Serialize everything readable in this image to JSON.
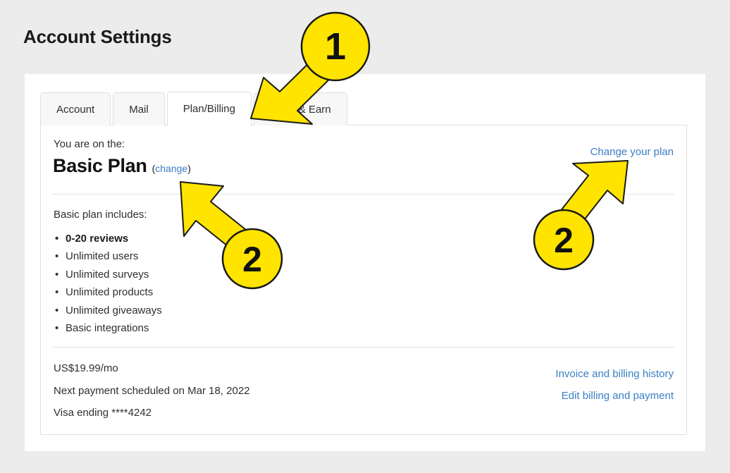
{
  "page": {
    "title": "Account Settings",
    "background_color": "#ececec",
    "card_background": "#ffffff"
  },
  "tabs": [
    {
      "label": "Account",
      "active": false
    },
    {
      "label": "Mail",
      "active": false
    },
    {
      "label": "Plan/Billing",
      "active": true
    },
    {
      "label": "Refer & Earn",
      "active": false
    }
  ],
  "plan": {
    "intro_label": "You are on the:",
    "name": "Basic Plan",
    "change_open_paren": "(",
    "change_link": "change",
    "change_close_paren": ")",
    "change_plan_link": "Change your plan",
    "includes_label": "Basic plan includes:",
    "features": [
      {
        "text": "0-20 reviews",
        "bold": true
      },
      {
        "text": "Unlimited users",
        "bold": false
      },
      {
        "text": "Unlimited surveys",
        "bold": false
      },
      {
        "text": "Unlimited products",
        "bold": false
      },
      {
        "text": "Unlimited giveaways",
        "bold": false
      },
      {
        "text": "Basic integrations",
        "bold": false
      }
    ]
  },
  "billing": {
    "price": "US$19.99/mo",
    "next_payment": "Next payment scheduled on Mar 18, 2022",
    "card": "Visa ending ****4242",
    "invoice_link": "Invoice and billing history",
    "edit_billing_link": "Edit billing and payment"
  },
  "annotations": {
    "accent_color": "#ffe400",
    "markers": [
      {
        "label": "1",
        "target": "plan-billing-tab"
      },
      {
        "label": "2",
        "target": "change-link"
      },
      {
        "label": "2",
        "target": "change-your-plan-link"
      }
    ]
  },
  "colors": {
    "link": "#3a7fc4",
    "text": "#2f2f2f",
    "heading": "#111111",
    "border": "#dfdfe1",
    "tab_inactive_bg": "#f7f7f8"
  }
}
